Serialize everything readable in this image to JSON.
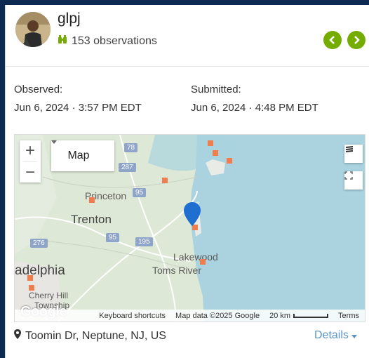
{
  "user": {
    "name": "glpj",
    "observations": "153 observations"
  },
  "observed": {
    "label": "Observed:",
    "value": "Jun 6, 2024 · 3:57 PM EDT"
  },
  "submitted": {
    "label": "Submitted:",
    "value": "Jun 6, 2024 · 4:48 PM EDT"
  },
  "map": {
    "zoom_in": "+",
    "zoom_out": "−",
    "type_label": "Map",
    "places": {
      "princeton": "Princeton",
      "trenton": "Trenton",
      "philadelphia": "adelphia",
      "lakewood": "Lakewood",
      "toms_river": "Toms River",
      "cherry_hill": "Cherry Hill",
      "township": "Township"
    },
    "shields": {
      "r78": "78",
      "r287": "287",
      "r95a": "95",
      "r95b": "95",
      "r276": "276",
      "r195": "195"
    },
    "google": "Google",
    "keyboard_shortcuts": "Keyboard shortcuts",
    "map_data": "Map data ©2025 Google",
    "scale": "20 km",
    "terms": "Terms"
  },
  "location": {
    "text": "Toomin Dr, Neptune, NJ, US"
  },
  "details_label": "Details",
  "colors": {
    "accent_green": "#74ac00",
    "link_blue": "#5a95c7",
    "pin_blue": "#1f6fd0",
    "marker_orange": "#f07e4d"
  }
}
